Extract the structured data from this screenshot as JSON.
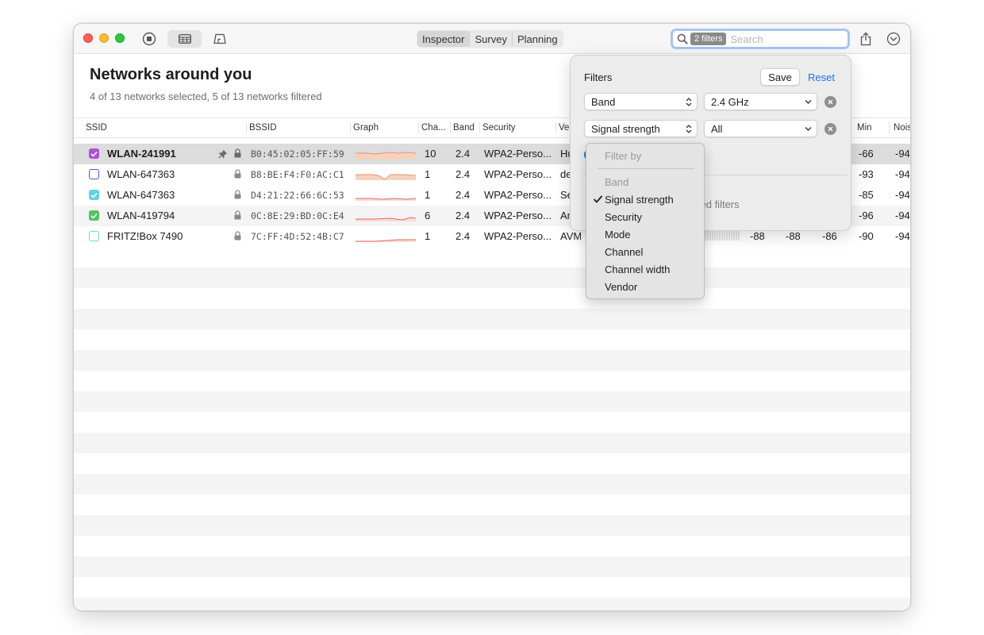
{
  "toolbar": {
    "tabs": [
      {
        "label": "Inspector",
        "active": true
      },
      {
        "label": "Survey",
        "active": false
      },
      {
        "label": "Planning",
        "active": false
      }
    ],
    "search": {
      "filter_token": "2 filters",
      "placeholder": "Search",
      "value": ""
    }
  },
  "main": {
    "title": "Networks around you",
    "subtitle": "4 of 13 networks selected, 5 of 13 networks filtered"
  },
  "table": {
    "columns": [
      "SSID",
      "BSSID",
      "Graph",
      "Cha...",
      "Band",
      "Security",
      "Ve",
      "Min",
      "Nois"
    ],
    "rows": [
      {
        "ssid": "WLAN-241991",
        "bssid": "B0:45:02:05:FF:59",
        "channel": "10",
        "band": "2.4",
        "security": "WPA2-Perso...",
        "vendor": "Hu",
        "extra": [
          "",
          "",
          ""
        ],
        "min": "-66",
        "noise": "-94",
        "checkbox_color": "#b04fd9",
        "checked": true,
        "pinned": true,
        "selected": true
      },
      {
        "ssid": "WLAN-647363",
        "bssid": "B8:BE:F4:F0:AC:C1",
        "channel": "1",
        "band": "2.4",
        "security": "WPA2-Perso...",
        "vendor": "de",
        "extra": [
          "",
          "",
          ""
        ],
        "min": "-93",
        "noise": "-94",
        "checkbox_color": "#5a53d6",
        "checked": false,
        "pinned": false,
        "selected": false
      },
      {
        "ssid": "WLAN-647363",
        "bssid": "D4:21:22:66:6C:53",
        "channel": "1",
        "band": "2.4",
        "security": "WPA2-Perso...",
        "vendor": "Se",
        "extra": [
          "",
          "",
          ""
        ],
        "min": "-85",
        "noise": "-94",
        "checkbox_color": "#5fd3e6",
        "checked": true,
        "pinned": false,
        "selected": false
      },
      {
        "ssid": "WLAN-419794",
        "bssid": "0C:8E:29:BD:0C:E4",
        "channel": "6",
        "band": "2.4",
        "security": "WPA2-Perso...",
        "vendor": "Ar",
        "extra": [
          "",
          "",
          ""
        ],
        "min": "-96",
        "noise": "-94",
        "checkbox_color": "#52c465",
        "checked": true,
        "pinned": false,
        "selected": false
      },
      {
        "ssid": "FRITZ!Box 7490",
        "bssid": "7C:FF:4D:52:4B:C7",
        "channel": "1",
        "band": "2.4",
        "security": "WPA2-Perso...",
        "vendor": "AVM",
        "extra": [
          "-88",
          "-88",
          "-86"
        ],
        "min": "-90",
        "noise": "-94",
        "checkbox_color": "#6fdcc8",
        "checked": false,
        "pinned": false,
        "selected": false
      }
    ]
  },
  "filters": {
    "title": "Filters",
    "save_label": "Save",
    "reset_label": "Reset",
    "rows": [
      {
        "field": "Band",
        "value": "2.4 GHz"
      },
      {
        "field": "Signal strength",
        "value": "All"
      }
    ],
    "saved_filters_text": "ved filters"
  },
  "filter_menu": {
    "header": "Filter by",
    "items": [
      {
        "label": "Band",
        "disabled": true,
        "checked": false
      },
      {
        "label": "Signal strength",
        "disabled": false,
        "checked": true
      },
      {
        "label": "Security",
        "disabled": false,
        "checked": false
      },
      {
        "label": "Mode",
        "disabled": false,
        "checked": false
      },
      {
        "label": "Channel",
        "disabled": false,
        "checked": false
      },
      {
        "label": "Channel width",
        "disabled": false,
        "checked": false
      },
      {
        "label": "Vendor",
        "disabled": false,
        "checked": false
      }
    ]
  }
}
